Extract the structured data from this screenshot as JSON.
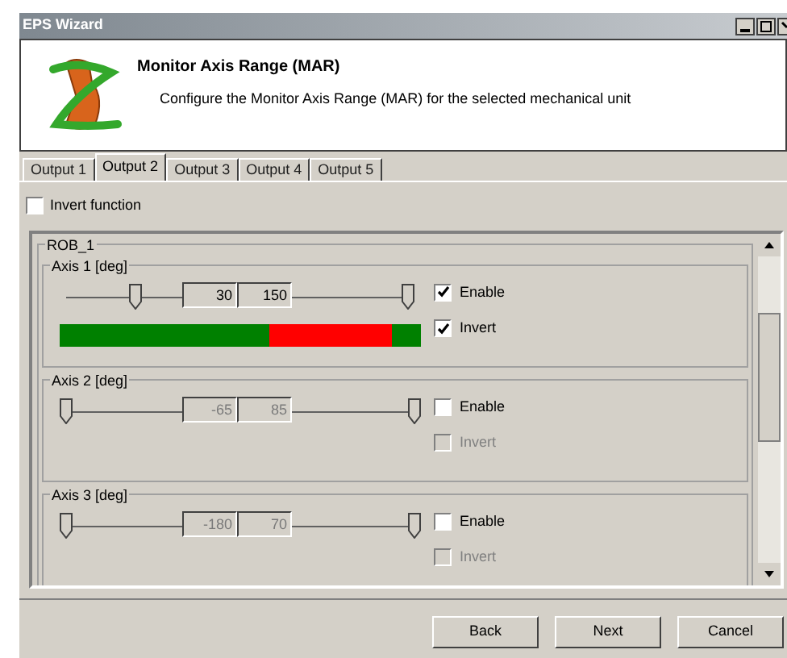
{
  "window": {
    "title": "EPS Wizard"
  },
  "header": {
    "title": "Monitor Axis Range (MAR)",
    "subtitle": "Configure the Monitor Axis Range (MAR) for the selected mechanical unit"
  },
  "tabs": [
    {
      "label": "Output 1",
      "selected": false
    },
    {
      "label": "Output 2",
      "selected": true
    },
    {
      "label": "Output 3",
      "selected": false
    },
    {
      "label": "Output 4",
      "selected": false
    },
    {
      "label": "Output 5",
      "selected": false
    }
  ],
  "invert_function": {
    "label": "Invert function",
    "checked": false
  },
  "group": {
    "title": "ROB_1",
    "axes": [
      {
        "title": "Axis 1 [deg]",
        "low": {
          "value": "30",
          "level": 0.2
        },
        "high": {
          "value": "150",
          "level": 0.98
        },
        "enable": {
          "label": "Enable",
          "checked": true
        },
        "invert": {
          "label": "Invert",
          "checked": true,
          "disabled": false
        },
        "disabled": false,
        "range_bar": {
          "color": "#008000",
          "fills": [
            {
              "color": "#ff0000",
              "level": 0.92
            },
            {
              "color": "#008000",
              "level": 0.58
            }
          ]
        }
      },
      {
        "title": "Axis 2 [deg]",
        "low": {
          "value": "-65",
          "level": 0
        },
        "high": {
          "value": "85",
          "level": 1
        },
        "enable": {
          "label": "Enable",
          "checked": false
        },
        "invert": {
          "label": "Invert",
          "checked": false,
          "disabled": true
        },
        "disabled": true
      },
      {
        "title": "Axis 3 [deg]",
        "low": {
          "value": "-180",
          "level": 0
        },
        "high": {
          "value": "70",
          "level": 1
        },
        "enable": {
          "label": "Enable",
          "checked": false
        },
        "invert": {
          "label": "Invert",
          "checked": false,
          "disabled": true
        },
        "disabled": true
      }
    ]
  },
  "buttons": [
    {
      "label": "Back"
    },
    {
      "label": "Next"
    },
    {
      "label": "Cancel"
    }
  ]
}
